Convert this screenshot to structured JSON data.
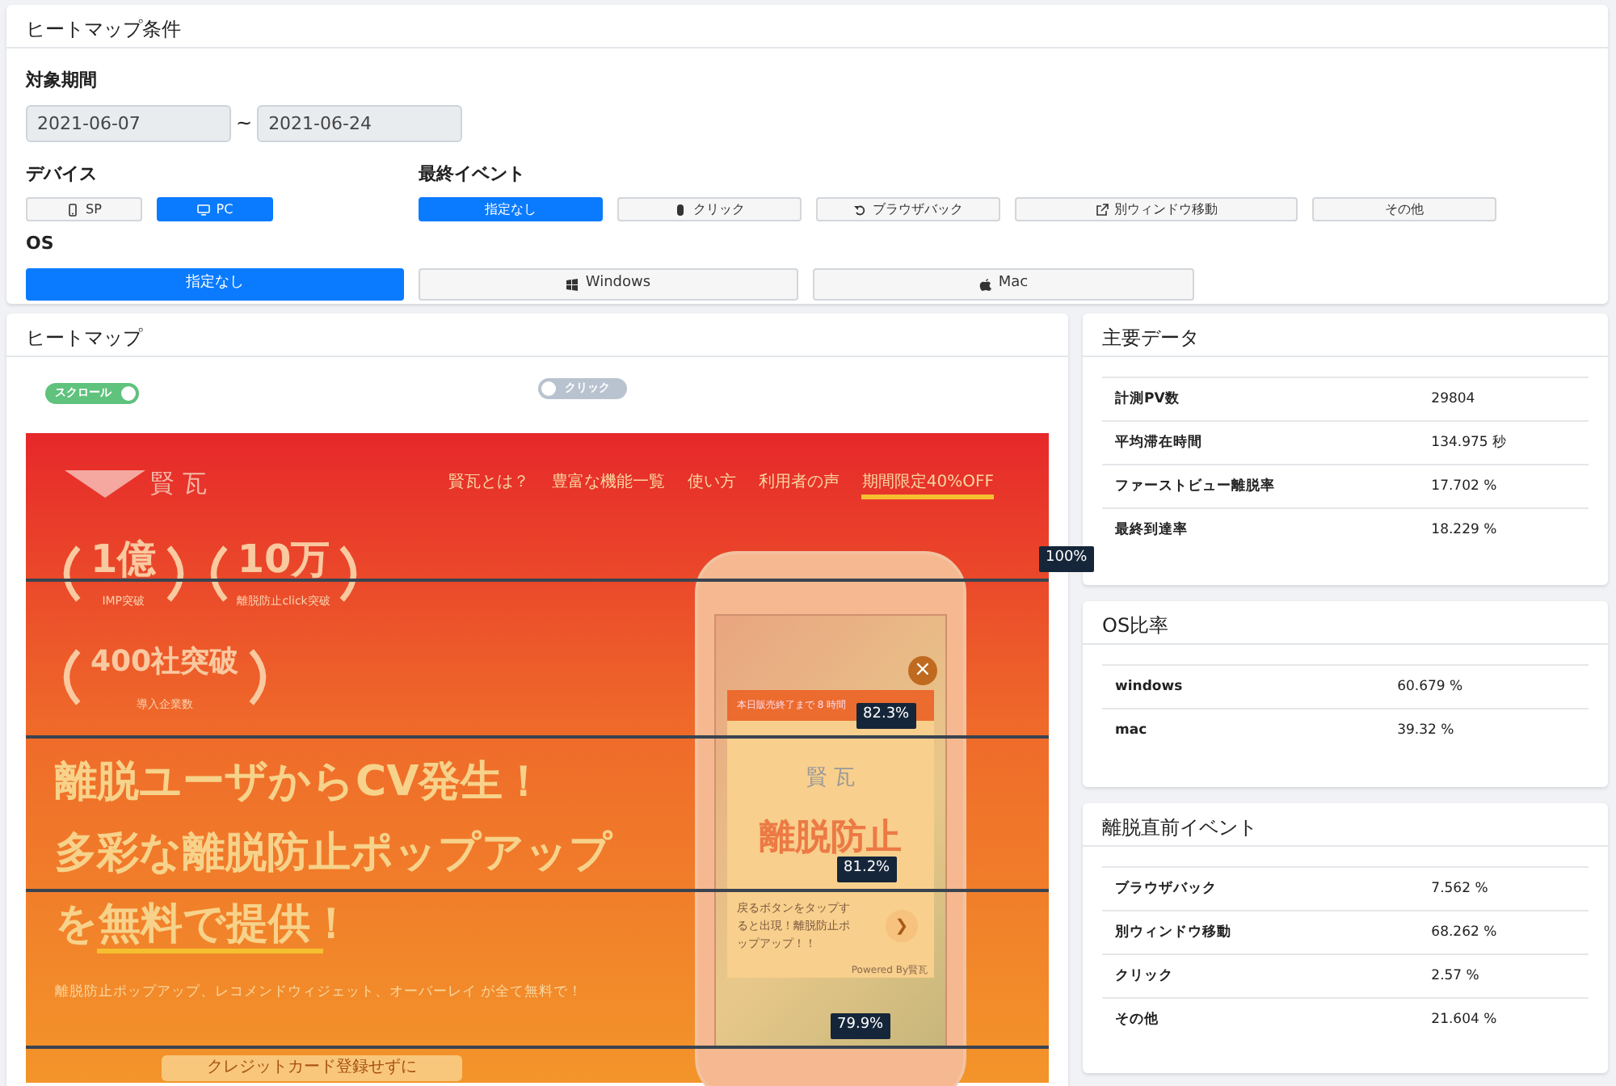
{
  "conditions": {
    "title": "ヒートマップ条件",
    "period": {
      "label": "対象期間",
      "from": "2021-06-07",
      "separator": "~",
      "to": "2021-06-24"
    },
    "device": {
      "label": "デバイス",
      "options": [
        {
          "kind": "sp",
          "label": "SP",
          "selected": false
        },
        {
          "kind": "pc",
          "label": "PC",
          "selected": true
        }
      ]
    },
    "last_event": {
      "label": "最終イベント",
      "options": [
        {
          "kind": "none",
          "label": "指定なし",
          "selected": true
        },
        {
          "kind": "click",
          "label": "クリック",
          "selected": false
        },
        {
          "kind": "back",
          "label": "ブラウザバック",
          "selected": false
        },
        {
          "kind": "window",
          "label": "別ウィンドウ移動",
          "selected": false
        },
        {
          "kind": "other",
          "label": "その他",
          "selected": false
        }
      ]
    },
    "os": {
      "label": "OS",
      "options": [
        {
          "kind": "none",
          "label": "指定なし",
          "selected": true
        },
        {
          "kind": "windows",
          "label": "Windows",
          "selected": false
        },
        {
          "kind": "mac",
          "label": "Mac",
          "selected": false
        }
      ]
    }
  },
  "heatmap": {
    "title": "ヒートマップ",
    "toggles": [
      {
        "label": "スクロール",
        "on": true
      },
      {
        "label": "クリック",
        "on": false
      }
    ],
    "page": {
      "logo_text": "賢 瓦",
      "nav": [
        {
          "label": "賢瓦とは？",
          "highlighted": false
        },
        {
          "label": "豊富な機能一覧",
          "highlighted": false
        },
        {
          "label": "使い方",
          "highlighted": false
        },
        {
          "label": "利用者の声",
          "highlighted": false
        },
        {
          "label": "期間限定40%OFF",
          "highlighted": true
        }
      ],
      "awards": [
        {
          "value": "1億",
          "caption": "IMP突破"
        },
        {
          "value": "10万",
          "caption": "離脱防止click突破"
        },
        {
          "value": "400社突破",
          "caption": "導入企業数"
        }
      ],
      "headline": [
        "離脱ユーザからCV発生！",
        "多彩な離脱防止ポップアップ",
        "を無料で提供！"
      ],
      "subline": "離脱防止ポップアップ、レコメンドウィジェット、オーバーレイ が全て無料で！",
      "cta": "クレジットカード登録せずに",
      "popup": {
        "countdown": "本日販売終了まで 8 時間",
        "logo_text": "賢 瓦",
        "title": "離脱防止",
        "message": "戻るボタンをタップすると出現！離脱防止ポップアップ！！",
        "arrow": "❯",
        "powered": "Powered By賢瓦",
        "close": "×"
      }
    },
    "scroll_markers": [
      {
        "label": "100%"
      },
      {
        "label": "82.3%"
      },
      {
        "label": "81.2%"
      },
      {
        "label": "79.9%"
      }
    ]
  },
  "stats": [
    {
      "title": "主要データ",
      "rows": [
        {
          "label": "計測PV数",
          "value": "29804"
        },
        {
          "label": "平均滞在時間",
          "value": "134.975 秒"
        },
        {
          "label": "ファーストビュー離脱率",
          "value": "17.702 %"
        },
        {
          "label": "最終到達率",
          "value": "18.229 %"
        }
      ]
    },
    {
      "title": "OS比率",
      "rows": [
        {
          "label": "windows",
          "value": "60.679 %"
        },
        {
          "label": "mac",
          "value": "39.32 %"
        }
      ]
    },
    {
      "title": "離脱直前イベント",
      "rows": [
        {
          "label": "ブラウザバック",
          "value": "7.562 %"
        },
        {
          "label": "別ウィンドウ移動",
          "value": "68.262 %"
        },
        {
          "label": "クリック",
          "value": "2.57 %"
        },
        {
          "label": "その他",
          "value": "21.604 %"
        }
      ]
    }
  ]
}
